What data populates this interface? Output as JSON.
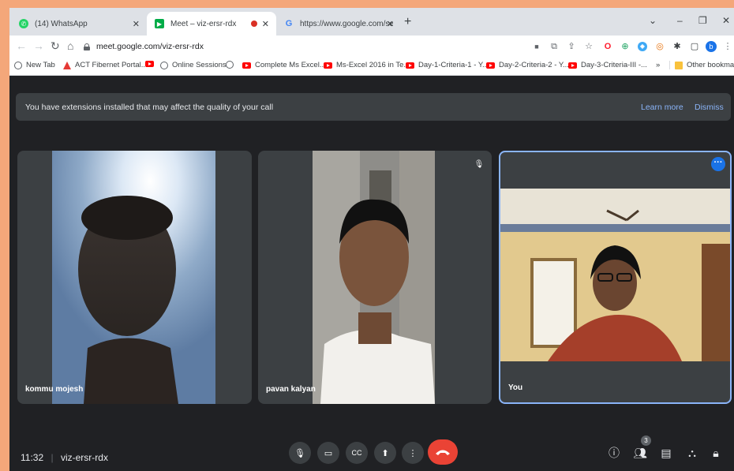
{
  "tabs": [
    {
      "title": "(14) WhatsApp",
      "favicon": "whatsapp-icon",
      "color": "#25D366"
    },
    {
      "title": "Meet – viz-ersr-rdx",
      "favicon": "meet-icon",
      "color": "#00AC47"
    },
    {
      "title": "https://www.google.com/search?",
      "favicon": "google-icon",
      "color": "#4285F4"
    }
  ],
  "toolbar": {
    "url": "meet.google.com/viz-ersr-rdx",
    "profile_initial": "b"
  },
  "bookmarks": [
    {
      "label": "New Tab",
      "icon": "globe-icon"
    },
    {
      "label": "ACT Fibernet Portal...",
      "icon": "act-icon"
    },
    {
      "label": "",
      "icon": "youtube-icon"
    },
    {
      "label": "Online Sessions",
      "icon": "globe-icon"
    },
    {
      "label": "",
      "icon": "globe-icon"
    },
    {
      "label": "Complete Ms Excel...",
      "icon": "youtube-icon"
    },
    {
      "label": "Ms-Excel 2016 in Te...",
      "icon": "youtube-icon"
    },
    {
      "label": "Day-1-Criteria-1 - Y...",
      "icon": "youtube-icon"
    },
    {
      "label": "Day-2-Criteria-2 - Y...",
      "icon": "youtube-icon"
    },
    {
      "label": "Day-3-Criteria-III -...",
      "icon": "youtube-icon"
    }
  ],
  "bookmarks_more": "»",
  "other_bookmarks": "Other bookmarks",
  "banner": {
    "message": "You have extensions installed that may affect the quality of your call",
    "learn_more": "Learn more",
    "dismiss": "Dismiss"
  },
  "participants": [
    {
      "name": "kommu mojesh",
      "muted": false
    },
    {
      "name": "pavan kalyan",
      "muted": true
    },
    {
      "name": "You",
      "muted": false
    }
  ],
  "meeting": {
    "time": "11:32",
    "code": "viz-ersr-rdx",
    "participant_count": "3"
  },
  "colors": {
    "accent": "#1A73E8",
    "end_call": "#EA4335",
    "link": "#8AB4F8",
    "page_bg": "#F4A77A"
  }
}
